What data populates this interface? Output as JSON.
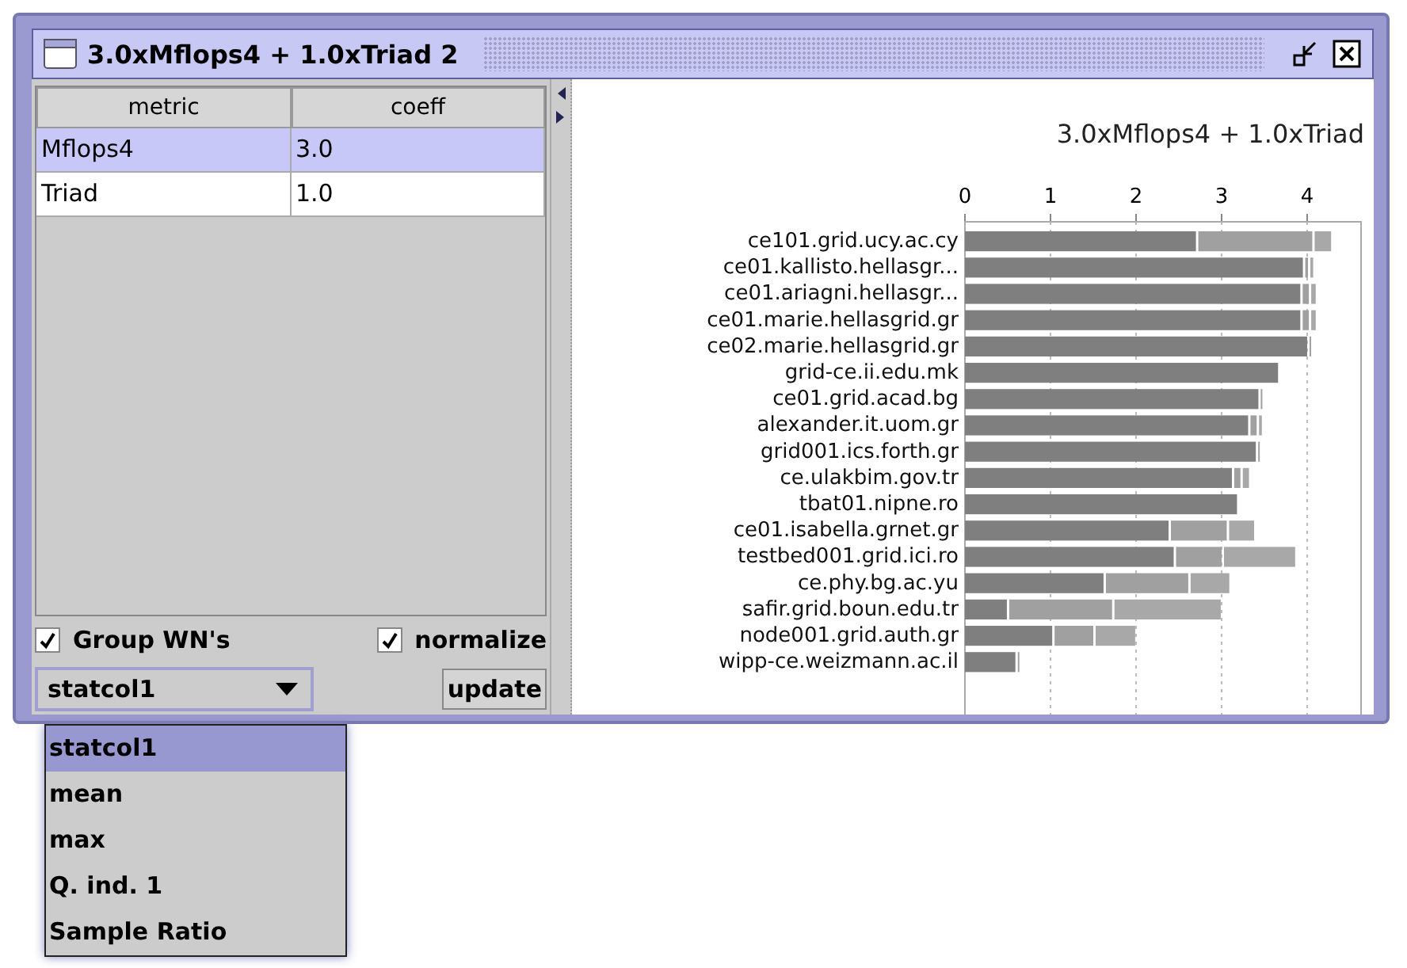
{
  "window": {
    "title": "3.0xMflops4 + 1.0xTriad 2"
  },
  "table": {
    "columns": [
      "metric",
      "coeff"
    ],
    "rows": [
      {
        "cells": [
          "Mflops4",
          "3.0"
        ],
        "selected": true
      },
      {
        "cells": [
          "Triad",
          "1.0"
        ],
        "selected": false
      }
    ]
  },
  "options": [
    {
      "label": "Group WN's",
      "checked": true
    },
    {
      "label": "normalize",
      "checked": true
    }
  ],
  "statistic_dropdown": {
    "value": "statcol1",
    "expanded": true,
    "items": [
      {
        "label": "statcol1",
        "selected": true
      },
      {
        "label": "mean",
        "selected": false
      },
      {
        "label": "max",
        "selected": false
      },
      {
        "label": "Q. ind. 1",
        "selected": false
      },
      {
        "label": "Sample Ratio",
        "selected": false
      }
    ]
  },
  "update_button": "update",
  "chart": {
    "chart_data": {
      "type": "bar",
      "orientation": "horizontal",
      "stacked": true,
      "title": "3.0xMflops4 + 1.0xTriad",
      "categories": [
        "ce101.grid.ucy.ac.cy",
        "ce01.kallisto.hellasgr...",
        "ce01.ariagni.hellasgr...",
        "ce01.marie.hellasgrid.gr",
        "ce02.marie.hellasgrid.gr",
        "grid-ce.ii.edu.mk",
        "ce01.grid.acad.bg",
        "alexander.it.uom.gr",
        "grid001.ics.forth.gr",
        "ce.ulakbim.gov.tr",
        "tbat01.nipne.ro",
        "ce01.isabella.grnet.gr",
        "testbed001.grid.ici.ro",
        "ce.phy.bg.ac.yu",
        "safir.grid.boun.edu.tr",
        "node001.grid.auth.gr",
        "wipp-ce.weizmann.ac.il"
      ],
      "series": [
        {
          "color": "#7f7f7f",
          "values": [
            2.7,
            3.95,
            3.92,
            3.92,
            4.0,
            3.66,
            3.43,
            3.31,
            3.4,
            3.12,
            3.18,
            2.38,
            2.44,
            1.62,
            0.49,
            1.02,
            0.59
          ]
        },
        {
          "color": "#a0a0a0",
          "values": [
            1.36,
            0.06,
            0.1,
            0.1,
            0.03,
            null,
            0.04,
            0.1,
            0.04,
            0.1,
            null,
            0.68,
            0.56,
            0.99,
            1.23,
            0.48,
            0.03
          ]
        },
        {
          "color": "#a8a8a8",
          "values": [
            0.22,
            0.06,
            0.08,
            0.08,
            null,
            null,
            null,
            0.06,
            null,
            0.1,
            null,
            0.32,
            0.86,
            0.48,
            1.27,
            0.49,
            null
          ]
        }
      ],
      "grid": true,
      "xlim": [
        0,
        4.63
      ],
      "xticks": [
        0,
        1,
        2,
        3,
        4
      ]
    }
  }
}
